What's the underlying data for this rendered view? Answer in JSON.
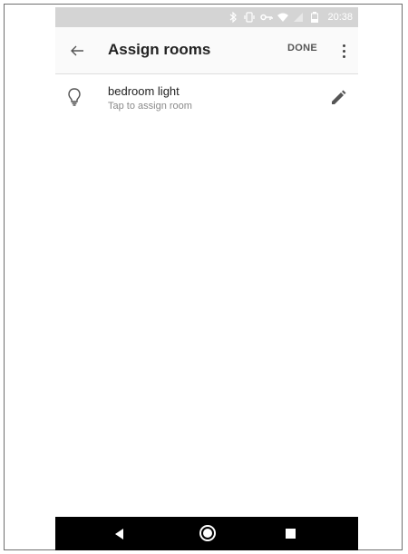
{
  "status_bar": {
    "time": "20:38",
    "icons": [
      "bluetooth-icon",
      "vibrate-icon",
      "vpn-key-icon",
      "wifi-icon",
      "signal-icon",
      "battery-icon"
    ]
  },
  "app_bar": {
    "title": "Assign rooms",
    "done_label": "DONE",
    "back_icon": "arrow-back-icon",
    "overflow_icon": "more-vert-icon"
  },
  "devices": [
    {
      "name": "bedroom light",
      "subtitle": "Tap to assign room",
      "icon": "lightbulb-icon",
      "action_icon": "edit-pencil-icon"
    }
  ],
  "nav_bar": {
    "icons": [
      "nav-back-icon",
      "nav-home-icon",
      "nav-recents-icon"
    ]
  },
  "colors": {
    "status_bar": "#d4d4d4",
    "app_bar": "#fafafa",
    "nav_bar": "#000000",
    "primary_text": "#222222",
    "secondary_text": "#8a8a8a"
  }
}
